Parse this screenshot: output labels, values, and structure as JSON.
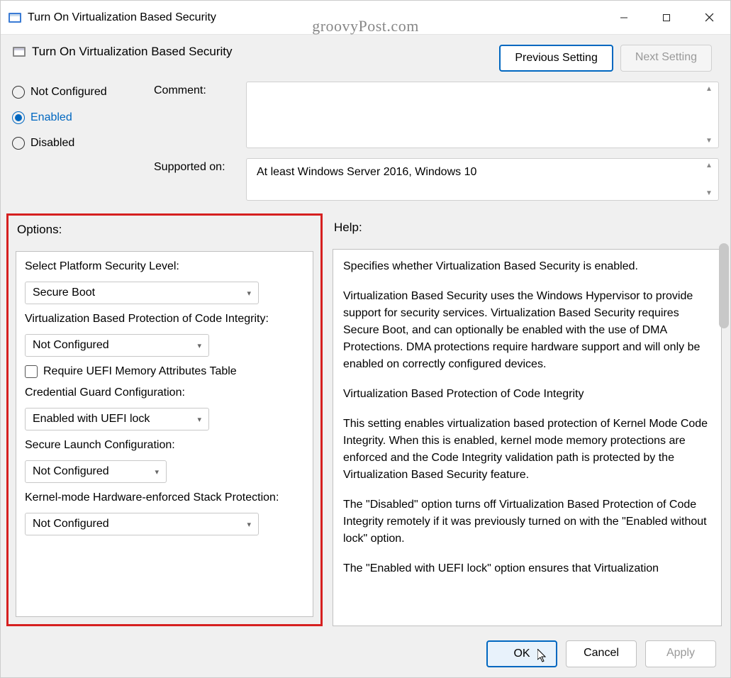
{
  "window": {
    "title": "Turn On Virtualization Based Security"
  },
  "watermark": "groovyPost.com",
  "header": {
    "title": "Turn On Virtualization Based Security",
    "prev": "Previous Setting",
    "next": "Next Setting"
  },
  "state": {
    "not_configured": "Not Configured",
    "enabled": "Enabled",
    "disabled": "Disabled",
    "selected": "enabled"
  },
  "comment": {
    "label": "Comment:",
    "value": ""
  },
  "supported": {
    "label": "Supported on:",
    "value": "At least Windows Server 2016, Windows 10"
  },
  "options": {
    "title": "Options:",
    "platform_label": "Select Platform Security Level:",
    "platform_value": "Secure Boot",
    "vbpci_label": "Virtualization Based Protection of Code Integrity:",
    "vbpci_value": "Not Configured",
    "uefi_checkbox": "Require UEFI Memory Attributes Table",
    "credguard_label": "Credential Guard Configuration:",
    "credguard_value": "Enabled with UEFI lock",
    "securelaunch_label": "Secure Launch Configuration:",
    "securelaunch_value": "Not Configured",
    "kernelstack_label": "Kernel-mode Hardware-enforced Stack Protection:",
    "kernelstack_value": "Not Configured"
  },
  "help": {
    "title": "Help:",
    "p1": "Specifies whether Virtualization Based Security is enabled.",
    "p2": "Virtualization Based Security uses the Windows Hypervisor to provide support for security services. Virtualization Based Security requires Secure Boot, and can optionally be enabled with the use of DMA Protections. DMA protections require hardware support and will only be enabled on correctly configured devices.",
    "p3": "Virtualization Based Protection of Code Integrity",
    "p4": "This setting enables virtualization based protection of Kernel Mode Code Integrity. When this is enabled, kernel mode memory protections are enforced and the Code Integrity validation path is protected by the Virtualization Based Security feature.",
    "p5": "The \"Disabled\" option turns off Virtualization Based Protection of Code Integrity remotely if it was previously turned on with the \"Enabled without lock\" option.",
    "p6": "The \"Enabled with UEFI lock\" option ensures that Virtualization"
  },
  "buttons": {
    "ok": "OK",
    "cancel": "Cancel",
    "apply": "Apply"
  }
}
